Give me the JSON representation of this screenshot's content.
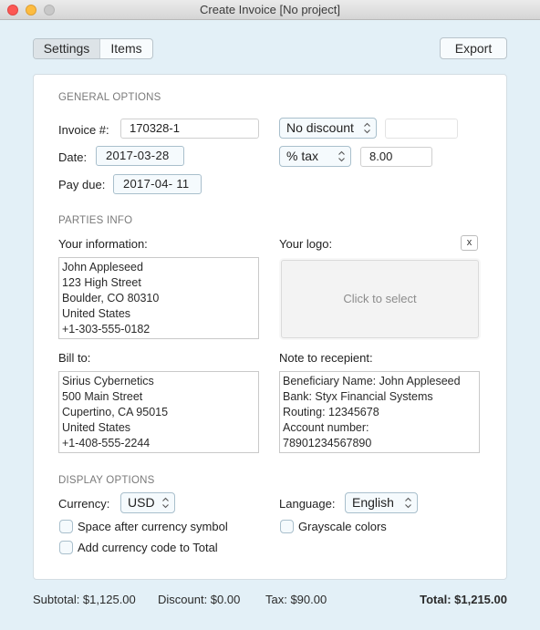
{
  "window": {
    "title": "Create Invoice [No project]"
  },
  "toolbar": {
    "tabs": [
      {
        "label": "Settings",
        "selected": true
      },
      {
        "label": "Items",
        "selected": false
      }
    ],
    "export_label": "Export"
  },
  "general_options": {
    "section_title": "GENERAL OPTIONS",
    "invoice_label": "Invoice #:",
    "invoice_value": "170328-1",
    "date_label": "Date:",
    "date_value": "2017-03-28",
    "pay_due_label": "Pay due:",
    "pay_due_value": "2017-04- 11",
    "discount_select": "No discount",
    "discount_value": "",
    "tax_select": "% tax",
    "tax_value": "8.00"
  },
  "parties_info": {
    "section_title": "PARTIES INFO",
    "your_info_label": "Your information:",
    "your_info_value": "John Appleseed\n123 High Street\nBoulder, CO 80310\nUnited States\n+1-303-555-0182",
    "your_logo_label": "Your logo:",
    "logo_clear_label": "x",
    "logo_placeholder": "Click to select",
    "bill_to_label": "Bill to:",
    "bill_to_value": "Sirius Cybernetics\n500 Main Street\nCupertino, CA 95015\nUnited States\n+1-408-555-2244",
    "note_label": "Note to recepient:",
    "note_value": "Beneficiary Name: John Appleseed\nBank: Styx Financial Systems\nRouting: 12345678\nAccount number:\n78901234567890"
  },
  "display_options": {
    "section_title": "DISPLAY OPTIONS",
    "currency_label": "Currency:",
    "currency_value": "USD",
    "language_label": "Language:",
    "language_value": "English",
    "checkboxes": [
      {
        "label": "Space after currency symbol",
        "checked": false
      },
      {
        "label": "Add currency code to Total",
        "checked": false
      },
      {
        "label": "Grayscale colors",
        "checked": false
      }
    ]
  },
  "totals": {
    "subtotal": "Subtotal: $1,125.00",
    "discount": "Discount: $0.00",
    "tax": "Tax: $90.00",
    "total": "Total: $1,215.00"
  }
}
